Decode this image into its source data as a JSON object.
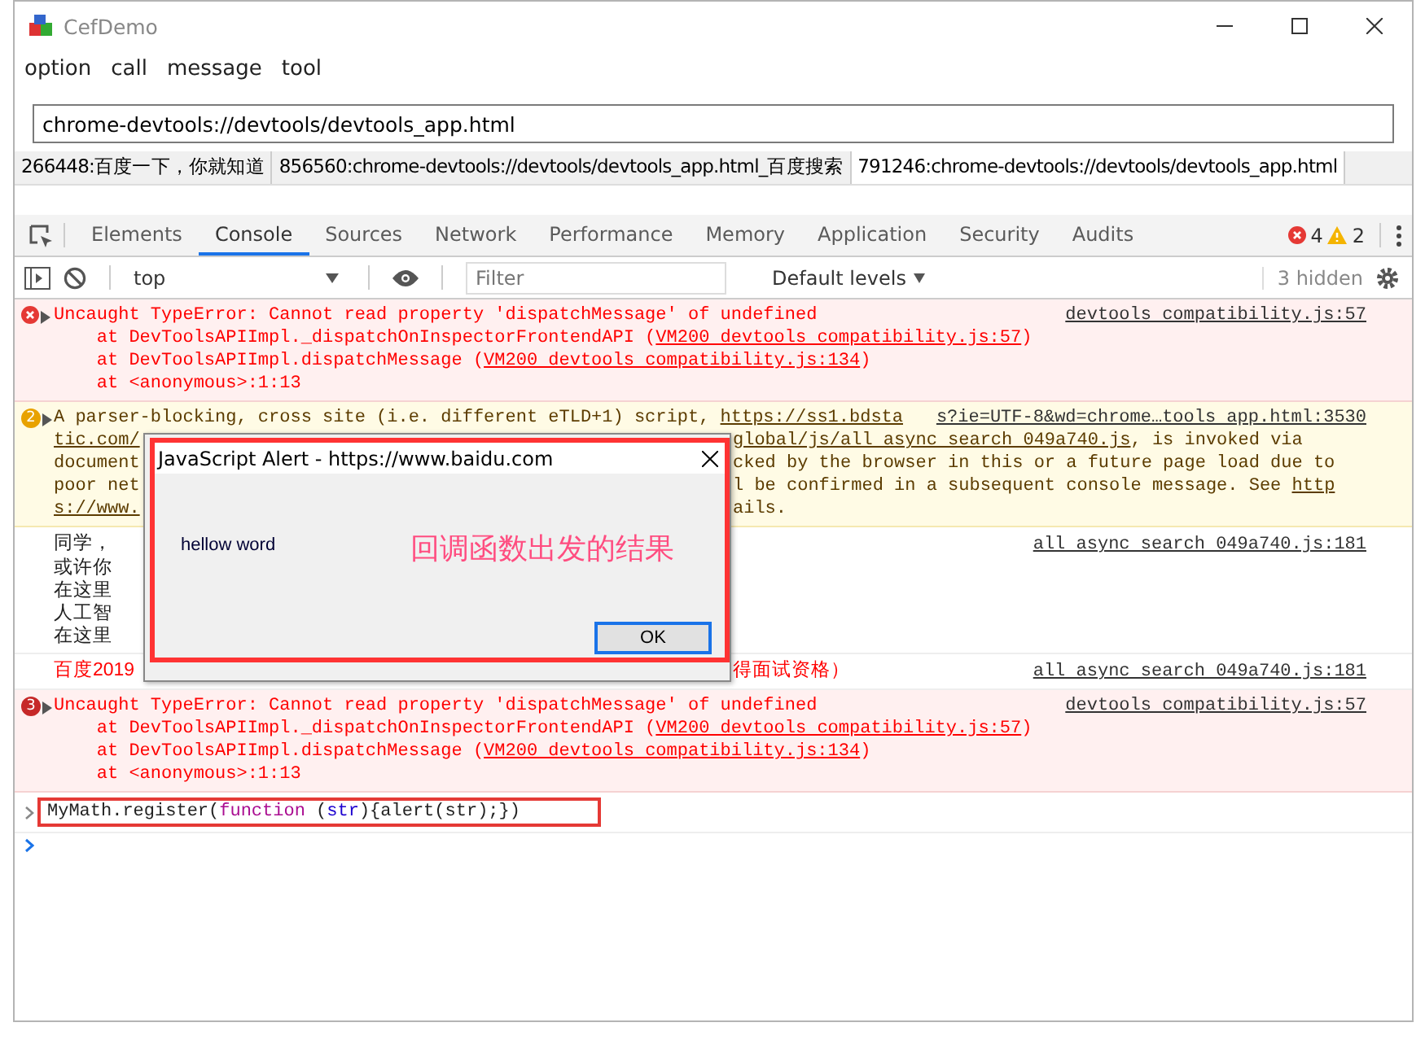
{
  "window": {
    "title": "CefDemo"
  },
  "menu": [
    "option",
    "call",
    "message",
    "tool"
  ],
  "address": {
    "value": "chrome-devtools://devtools/devtools_app.html"
  },
  "page_tabs": [
    {
      "label": "266448:百度一下，你就知道",
      "selected": false
    },
    {
      "label": "856560:chrome-devtools://devtools/devtools_app.html_百度搜索",
      "selected": false
    },
    {
      "label": "791246:chrome-devtools://devtools/devtools_app.html",
      "selected": true
    }
  ],
  "devtools": {
    "tabs": [
      {
        "label": "Elements",
        "selected": false
      },
      {
        "label": "Console",
        "selected": true
      },
      {
        "label": "Sources",
        "selected": false
      },
      {
        "label": "Network",
        "selected": false
      },
      {
        "label": "Performance",
        "selected": false
      },
      {
        "label": "Memory",
        "selected": false
      },
      {
        "label": "Application",
        "selected": false
      },
      {
        "label": "Security",
        "selected": false
      },
      {
        "label": "Audits",
        "selected": false
      }
    ],
    "error_count": "4",
    "warning_count": "2",
    "context": "top",
    "filter": {
      "placeholder": "Filter"
    },
    "levels": "Default levels",
    "hidden": "3 hidden"
  },
  "messages": [
    {
      "kind": "error",
      "source": "devtools compatibility.js:57",
      "lines": [
        {
          "parts": [
            {
              "text": "Uncaught TypeError: Cannot read property 'dispatchMessage' of undefined",
              "link": false
            }
          ]
        },
        {
          "parts": [
            {
              "text": "    at DevToolsAPIImpl._dispatchOnInspectorFrontendAPI (",
              "link": false
            },
            {
              "text": "VM200 devtools compatibility.js:57",
              "link": true
            },
            {
              "text": ")",
              "link": false
            }
          ]
        },
        {
          "parts": [
            {
              "text": "    at DevToolsAPIImpl.dispatchMessage (",
              "link": false
            },
            {
              "text": "VM200 devtools compatibility.js:134",
              "link": true
            },
            {
              "text": ")",
              "link": false
            }
          ]
        },
        {
          "parts": [
            {
              "text": "    at <anonymous>:1:13",
              "link": false
            }
          ]
        }
      ]
    },
    {
      "kind": "warning",
      "badge": "2",
      "source": "s?ie=UTF-8&wd=chrome…tools app.html:3530",
      "lines": [
        {
          "parts": [
            {
              "text": "A parser-blocking, cross site (i.e. different eTLD+1) script, ",
              "link": false
            },
            {
              "text": "https://ss1.bdsta",
              "link": true
            }
          ]
        },
        {
          "parts": [
            {
              "text": "tic.com/",
              "link": true
            }
          ],
          "after_dialog": [
            {
              "text": "global/js/all async search 049a740.js",
              "link": true
            },
            {
              "text": ", is invoked via",
              "link": false
            }
          ]
        },
        {
          "parts": [
            {
              "text": "document",
              "link": false
            }
          ],
          "after_dialog": [
            {
              "text": "cked by the browser in this or a future page load due to",
              "link": false
            }
          ]
        },
        {
          "parts": [
            {
              "text": "poor net",
              "link": false
            }
          ],
          "after_dialog": [
            {
              "text": "l be confirmed in a subsequent console message. See ",
              "link": false
            },
            {
              "text": "http",
              "link": true
            }
          ]
        },
        {
          "parts": [
            {
              "text": "s://www.",
              "link": true
            }
          ],
          "after_dialog": [
            {
              "text": "ails.",
              "link": false
            }
          ]
        }
      ]
    },
    {
      "kind": "info",
      "source": "all async search 049a740.js:181",
      "lines": [
        {
          "parts": [
            {
              "text": "同学，",
              "link": false
            }
          ]
        },
        {
          "parts": [
            {
              "text": "或许你",
              "link": false
            }
          ]
        },
        {
          "parts": [
            {
              "text": "在这里",
              "link": false
            }
          ]
        },
        {
          "parts": [
            {
              "text": "人工智",
              "link": false
            }
          ]
        },
        {
          "parts": [
            {
              "text": "在这里",
              "link": false
            }
          ]
        }
      ]
    },
    {
      "kind": "info-red",
      "source": "all async search 049a740.js:181",
      "lines": [
        {
          "parts": [
            {
              "text": "百度2019",
              "link": false
            }
          ],
          "after_dialog": [
            {
              "text": "得面试资格）",
              "link": false
            }
          ]
        }
      ]
    },
    {
      "kind": "error",
      "badge": "3",
      "source": "devtools compatibility.js:57",
      "lines": [
        {
          "parts": [
            {
              "text": "Uncaught TypeError: Cannot read property 'dispatchMessage' of undefined",
              "link": false
            }
          ]
        },
        {
          "parts": [
            {
              "text": "    at DevToolsAPIImpl._dispatchOnInspectorFrontendAPI (",
              "link": false
            },
            {
              "text": "VM200 devtools compatibility.js:57",
              "link": true
            },
            {
              "text": ")",
              "link": false
            }
          ]
        },
        {
          "parts": [
            {
              "text": "    at DevToolsAPIImpl.dispatchMessage (",
              "link": false
            },
            {
              "text": "VM200 devtools compatibility.js:134",
              "link": true
            },
            {
              "text": ")",
              "link": false
            }
          ]
        },
        {
          "parts": [
            {
              "text": "    at <anonymous>:1:13",
              "link": false
            }
          ]
        }
      ]
    }
  ],
  "input": [
    {
      "text": "MyMath.register(",
      "kind": "plain"
    },
    {
      "text": "function",
      "kind": "keyword"
    },
    {
      "text": " (",
      "kind": "plain"
    },
    {
      "text": "str",
      "kind": "variable"
    },
    {
      "text": "){alert(str);})",
      "kind": "plain"
    }
  ],
  "dialog": {
    "title": "JavaScript Alert - https://www.baidu.com",
    "message": "hellow word",
    "annotation": "回调函数出发的结果",
    "button": "OK"
  }
}
